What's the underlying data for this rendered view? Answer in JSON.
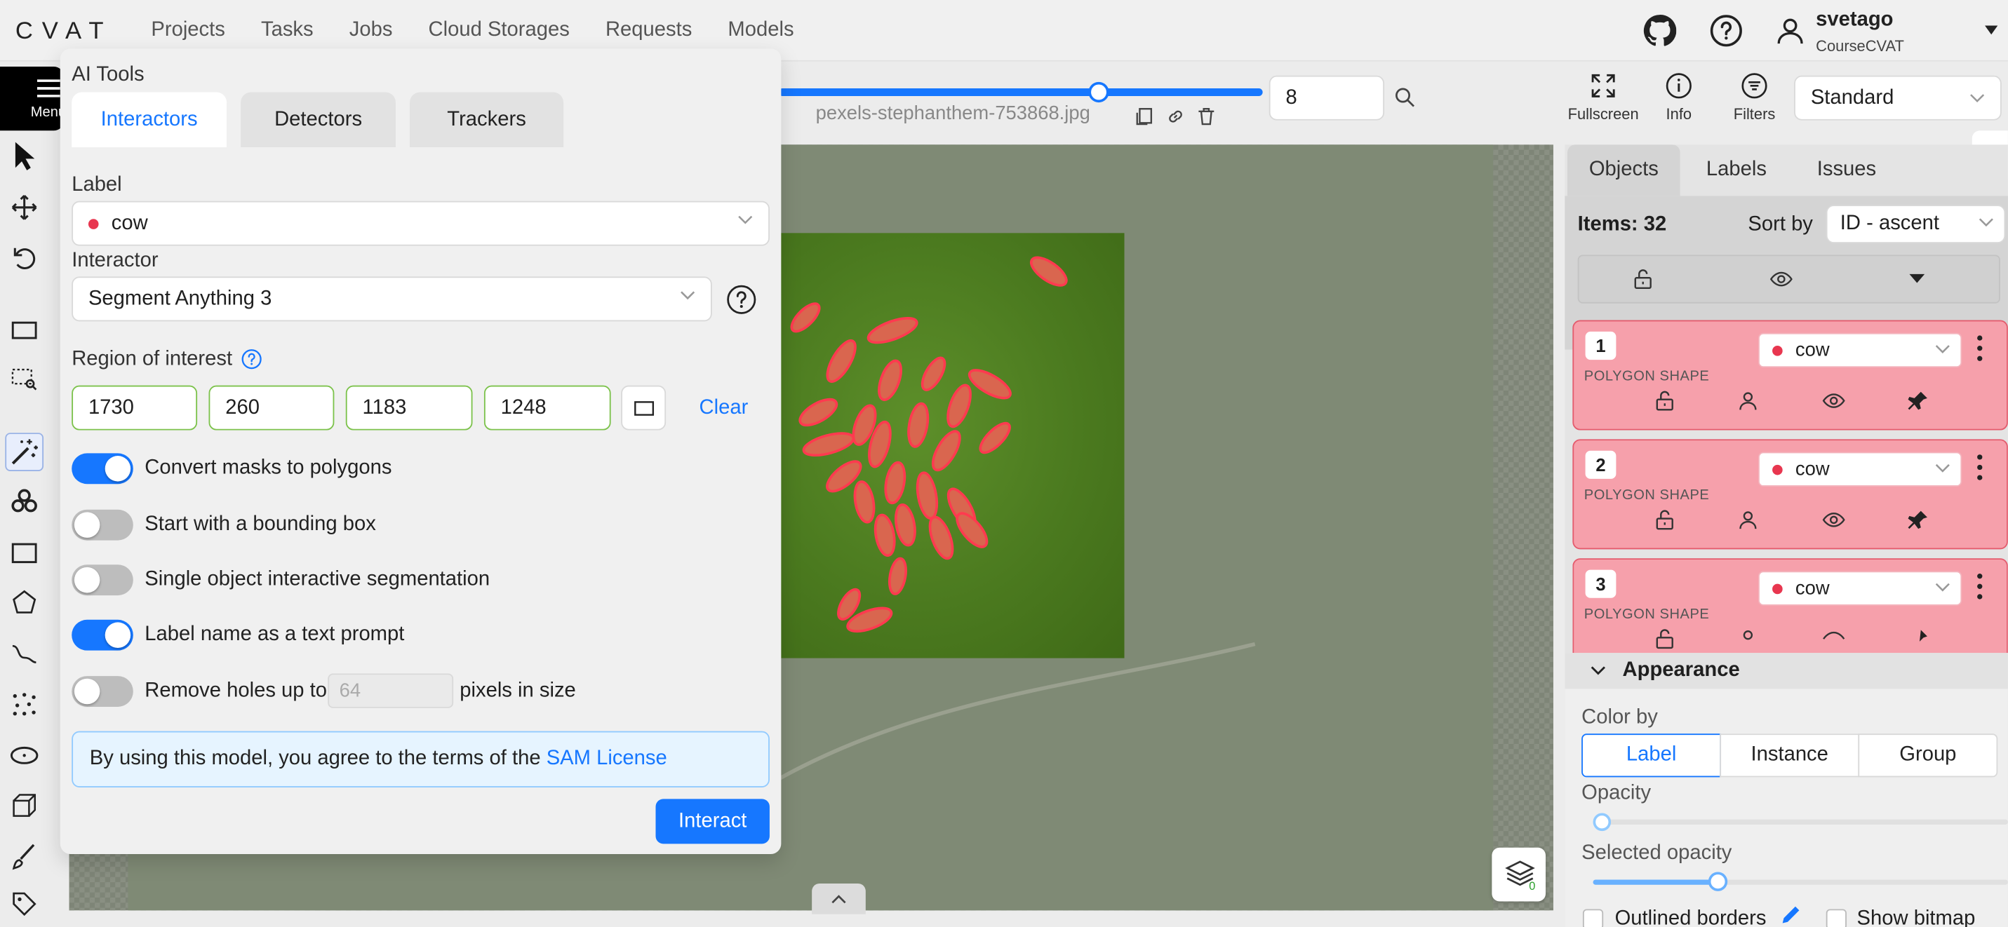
{
  "app": {
    "logo": "CVAT",
    "nav": [
      "Projects",
      "Tasks",
      "Jobs",
      "Cloud Storages",
      "Requests",
      "Models"
    ],
    "user": {
      "name": "svetago",
      "org": "CourseCVAT"
    }
  },
  "left_toolbar": {
    "menu_label": "Menu"
  },
  "player": {
    "filename": "pexels-stephanthem-753868.jpg",
    "frame": "8",
    "buttons": {
      "fullscreen": "Fullscreen",
      "info": "Info",
      "filters": "Filters"
    },
    "workspace": "Standard"
  },
  "ai_tools": {
    "title": "AI Tools",
    "tabs": [
      "Interactors",
      "Detectors",
      "Trackers"
    ],
    "label_title": "Label",
    "label_value": "cow",
    "interactor_title": "Interactor",
    "interactor_value": "Segment Anything 3",
    "roi_title": "Region of interest",
    "roi": [
      "1730",
      "260",
      "1183",
      "1248"
    ],
    "clear": "Clear",
    "toggles": [
      {
        "label": "Convert masks to polygons",
        "on": true
      },
      {
        "label": "Start with a bounding box",
        "on": false
      },
      {
        "label": "Single object interactive segmentation",
        "on": false
      },
      {
        "label": "Label name as a text prompt",
        "on": true
      }
    ],
    "holes": {
      "prefix": "Remove holes up to",
      "value": "64",
      "suffix": "pixels in size",
      "on": false
    },
    "license_text": "By using this model, you agree to the terms of the",
    "license_link": "SAM License",
    "interact": "Interact"
  },
  "objects_panel": {
    "tabs": [
      "Objects",
      "Labels",
      "Issues"
    ],
    "items_count": "Items: 32",
    "sort_label": "Sort by",
    "sort_value": "ID - ascent",
    "objects": [
      {
        "id": "1",
        "type": "POLYGON SHAPE",
        "label": "cow"
      },
      {
        "id": "2",
        "type": "POLYGON SHAPE",
        "label": "cow"
      },
      {
        "id": "3",
        "type": "POLYGON SHAPE",
        "label": "cow"
      }
    ],
    "appearance": {
      "title": "Appearance",
      "color_by": "Color by",
      "color_options": [
        "Label",
        "Instance",
        "Group"
      ],
      "opacity": "Opacity",
      "opacity_value": 0.0,
      "selected_opacity": "Selected opacity",
      "selected_opacity_value": 0.3,
      "outlined": "Outlined borders",
      "show_bitmap": "Show bitmap"
    }
  },
  "colors": {
    "accent": "#1677ff",
    "object_card": "#f6a0ab",
    "label_dot": "#e8364f"
  }
}
